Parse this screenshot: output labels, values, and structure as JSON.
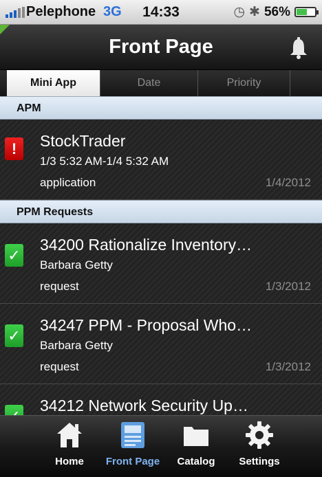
{
  "status_bar": {
    "carrier": "Pelephone",
    "network": "3G",
    "time": "14:33",
    "battery": "56%",
    "battery_level": 0.56,
    "clock_icon": "clock-icon",
    "bluetooth_icon": "bluetooth-icon"
  },
  "header": {
    "title": "Front Page",
    "bell_icon": "bell-icon"
  },
  "tabs": [
    {
      "label": "Mini App",
      "active": true
    },
    {
      "label": "Date",
      "active": false
    },
    {
      "label": "Priority",
      "active": false
    }
  ],
  "sections": [
    {
      "header": "APM",
      "items": [
        {
          "title": "StockTrader",
          "subtitle": "1/3 5:32 AM-1/4 5:32 AM",
          "type": "application",
          "date": "1/4/2012",
          "flag": "!",
          "flag_color": "#d11111"
        }
      ]
    },
    {
      "header": "PPM Requests",
      "items": [
        {
          "title": "34200 Rationalize Inventory…",
          "subtitle": "Barbara Getty",
          "type": "request",
          "date": "1/3/2012",
          "flag": "✓",
          "flag_color": "#2bb53a"
        },
        {
          "title": "34247 PPM - Proposal Who…",
          "subtitle": "Barbara Getty",
          "type": "request",
          "date": "1/3/2012",
          "flag": "✓",
          "flag_color": "#2bb53a"
        },
        {
          "title": "34212 Network Security Up…",
          "flag": "✓",
          "flag_color": "#2bb53a"
        }
      ]
    }
  ],
  "tabbar": [
    {
      "label": "Home",
      "icon": "home-icon",
      "active": false
    },
    {
      "label": "Front Page",
      "icon": "front-page-icon",
      "active": true
    },
    {
      "label": "Catalog",
      "icon": "folder-icon",
      "active": false
    },
    {
      "label": "Settings",
      "icon": "gear-icon",
      "active": false
    }
  ],
  "colors": {
    "accent_active_tab": "#7fb3ef",
    "section_header": "#d6e3f0"
  }
}
